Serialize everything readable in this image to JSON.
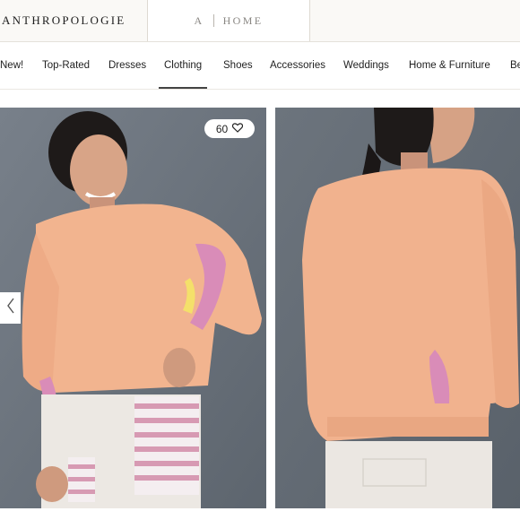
{
  "header": {
    "brand": "ANTHROPOLOGIE",
    "home_tab": {
      "prefix": "A",
      "label": "HOME"
    }
  },
  "nav": {
    "items": [
      {
        "label": "New!"
      },
      {
        "label": "Top-Rated"
      },
      {
        "label": "Dresses"
      },
      {
        "label": "Clothing",
        "active": true
      },
      {
        "label": "Shoes"
      },
      {
        "label": "Accessories"
      },
      {
        "label": "Weddings"
      },
      {
        "label": "Home & Furniture"
      },
      {
        "label": "Be"
      }
    ]
  },
  "gallery": {
    "favorites_count": "60",
    "icons": {
      "favorite": "heart-icon",
      "previous": "chevron-left-icon"
    },
    "colors": {
      "backdrop": "#6f7780",
      "sweatshirt": "#f3b690",
      "accent_print": "#d98cb8"
    }
  }
}
